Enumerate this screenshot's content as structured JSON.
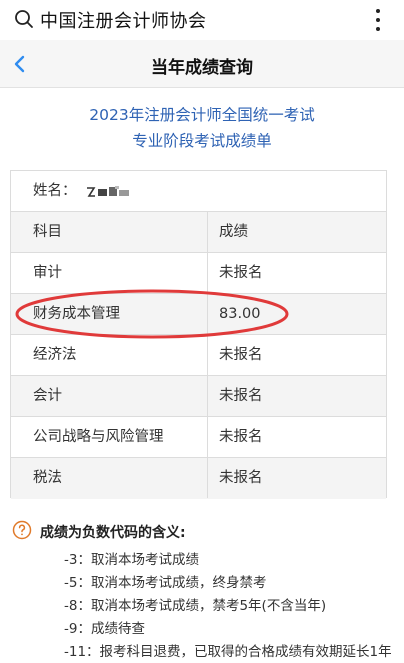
{
  "app": {
    "title": "中国注册会计师协会",
    "search_icon": "search-icon",
    "more_icon": "more-vertical-icon"
  },
  "nav": {
    "title": "当年成绩查询",
    "back_icon": "chevron-left-icon"
  },
  "heading": {
    "line1": "2023年注册会计师全国统一考试",
    "line2": "专业阶段考试成绩单"
  },
  "colors": {
    "heading_blue": "#2f63b4",
    "highlight_red": "#e03a3a"
  },
  "table": {
    "name_label": "姓名：",
    "header": {
      "subject": "科目",
      "score": "成绩"
    },
    "rows": [
      {
        "subject": "审计",
        "score": "未报名"
      },
      {
        "subject": "财务成本管理",
        "score": "83.00"
      },
      {
        "subject": "经济法",
        "score": "未报名"
      },
      {
        "subject": "会计",
        "score": "未报名"
      },
      {
        "subject": "公司战略与风险管理",
        "score": "未报名"
      },
      {
        "subject": "税法",
        "score": "未报名"
      }
    ]
  },
  "notes": {
    "title": "成绩为负数代码的含义:",
    "items": [
      "-3：取消本场考试成绩",
      "-5：取消本场考试成绩，终身禁考",
      "-8：取消本场考试成绩，禁考5年(不含当年)",
      "-9：成绩待查",
      "-11：报考科目退费，已取得的合格成绩有效期延长1年"
    ]
  }
}
